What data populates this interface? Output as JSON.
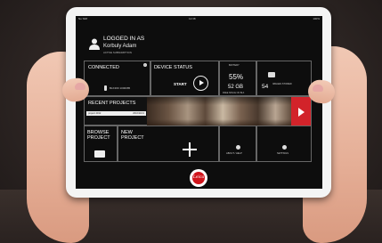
{
  "status_bar": {
    "carrier": "No SIM",
    "time": "12:38",
    "battery": "100%"
  },
  "header": {
    "logged_in_as": "LOGGED IN AS",
    "user_name": "Korbuly Adam",
    "subscription": "ACTIVE SUBSCRIPTION"
  },
  "connected": {
    "title": "CONNECTED",
    "device_id": "BLK360 1000085"
  },
  "device_status": {
    "title": "DEVICE STATUS",
    "start_label": "START"
  },
  "battery": {
    "label": "BATTERY",
    "value": "55%"
  },
  "storage": {
    "value": "52 GB",
    "label": "FREE SPACE ON BLK"
  },
  "photos": {
    "count": "54",
    "label": "IMAGES STORED"
  },
  "recent_projects": {
    "title": "RECENT PROJECTS",
    "items": [
      {
        "name": "project 4192",
        "date": "2016/11/13"
      }
    ]
  },
  "browse": {
    "label": "BROWSE PROJECT"
  },
  "new_project": {
    "label": "NEW PROJECT"
  },
  "about": {
    "label": "ABOUT / HELP"
  },
  "settings": {
    "label": "SETTINGS"
  },
  "brand": {
    "logo_text": "Leica",
    "color": "#d0151c"
  },
  "colors": {
    "accent": "#d2232a",
    "screen_bg": "#0d0d0d"
  }
}
